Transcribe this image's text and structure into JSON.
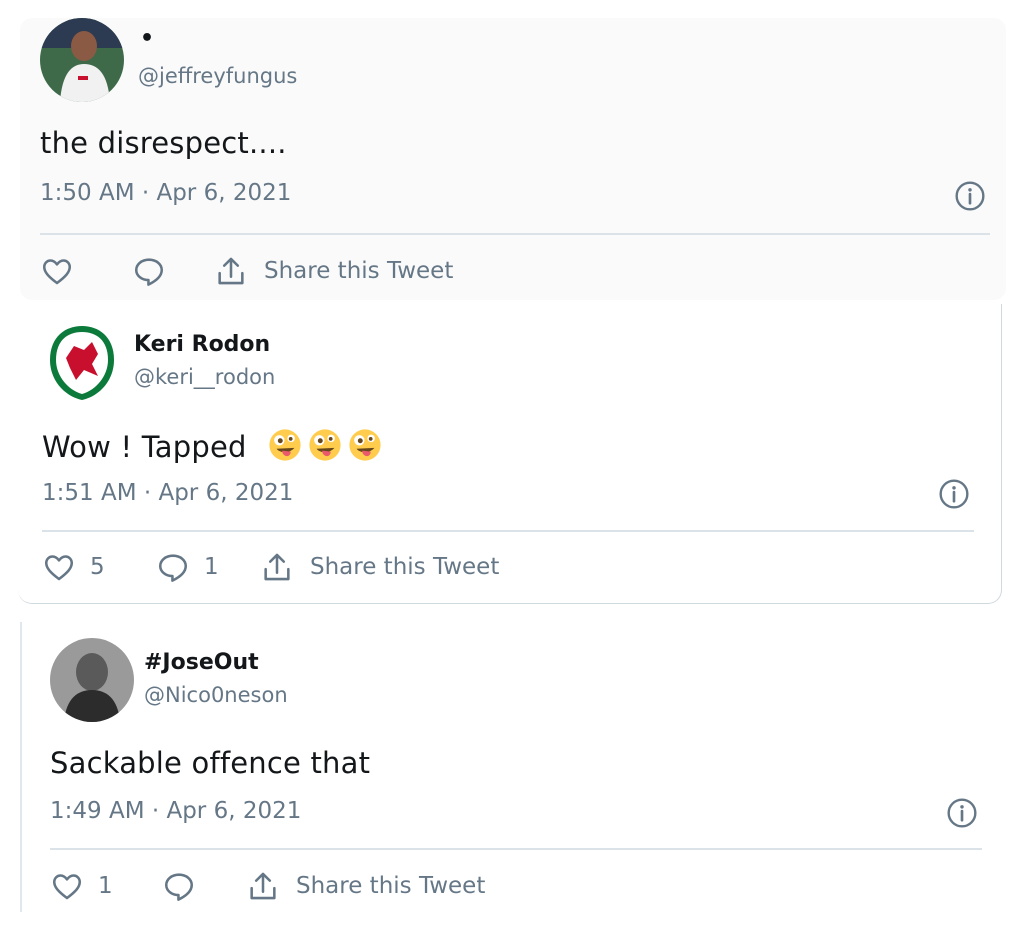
{
  "tweets": [
    {
      "name": "•",
      "handle": "@jeffreyfungus",
      "text": "the disrespect....",
      "time": "1:50 AM · Apr 6, 2021",
      "likes": "",
      "replies": "",
      "share_label": "Share this Tweet"
    },
    {
      "name": "Keri Rodon",
      "handle": "@keri__rodon",
      "text": "Wow ! Tapped",
      "emoji": "zany-face",
      "time": "1:51 AM · Apr 6, 2021",
      "likes": "5",
      "replies": "1",
      "share_label": "Share this Tweet"
    },
    {
      "name": "#JoseOut",
      "handle": "@Nico0neson",
      "text": "Sackable offence that",
      "time": "1:49 AM · Apr 6, 2021",
      "likes": "1",
      "replies": "",
      "share_label": "Share this Tweet"
    }
  ],
  "colors": {
    "text": "#14171a",
    "muted": "#657786",
    "divider": "#dbe3e8"
  }
}
